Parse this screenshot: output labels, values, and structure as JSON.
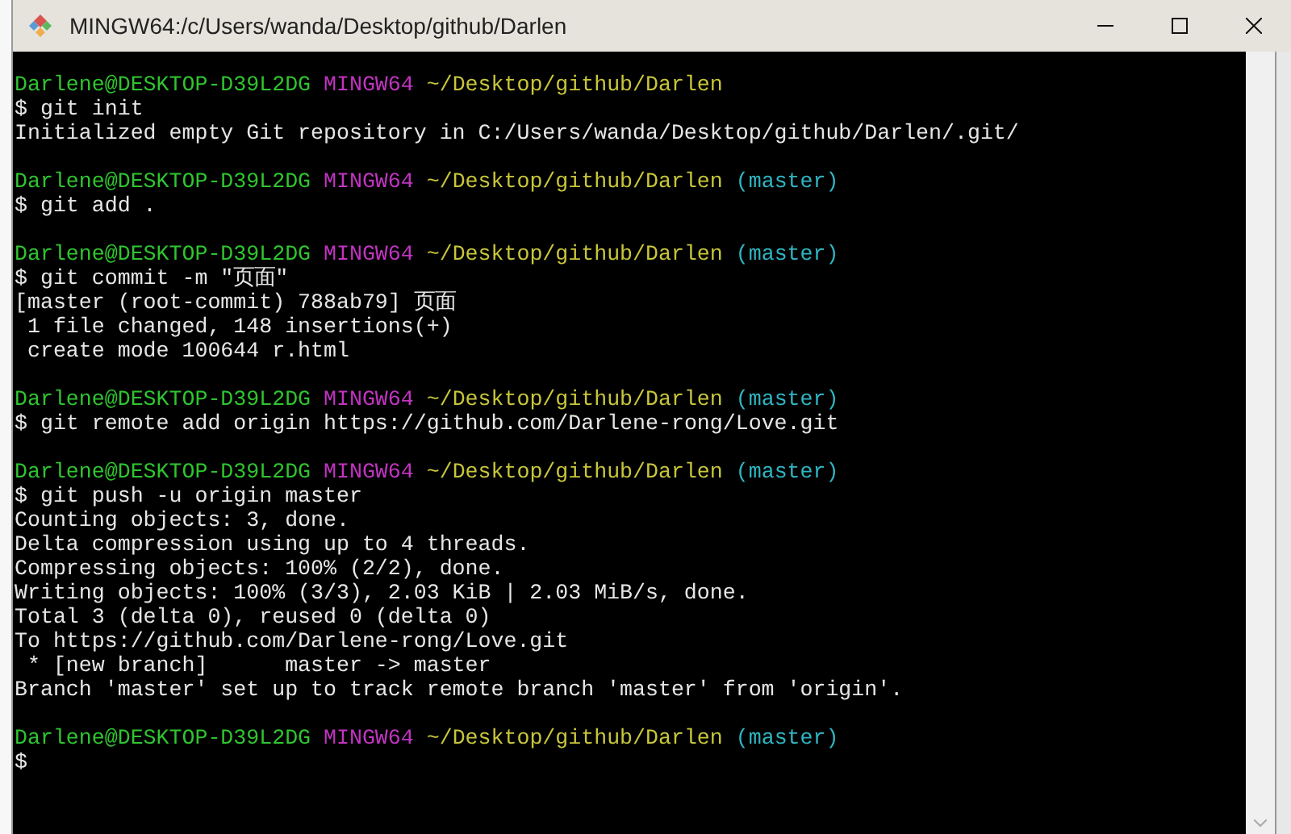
{
  "window": {
    "title": "MINGW64:/c/Users/wanda/Desktop/github/Darlen"
  },
  "terminal": {
    "lines": [
      {
        "kind": "prompt",
        "user": "Darlene@DESKTOP-D39L2DG",
        "system": "MINGW64",
        "path": "~/Desktop/github/Darlen"
      },
      {
        "kind": "command",
        "symbol": "$",
        "text": "git init"
      },
      {
        "kind": "output",
        "text": "Initialized empty Git repository in C:/Users/wanda/Desktop/github/Darlen/.git/"
      },
      {
        "kind": "blank"
      },
      {
        "kind": "prompt",
        "user": "Darlene@DESKTOP-D39L2DG",
        "system": "MINGW64",
        "path": "~/Desktop/github/Darlen",
        "branch": "(master)"
      },
      {
        "kind": "command",
        "symbol": "$",
        "text": "git add ."
      },
      {
        "kind": "blank"
      },
      {
        "kind": "prompt",
        "user": "Darlene@DESKTOP-D39L2DG",
        "system": "MINGW64",
        "path": "~/Desktop/github/Darlen",
        "branch": "(master)"
      },
      {
        "kind": "command",
        "symbol": "$",
        "text": "git commit -m \"页面\""
      },
      {
        "kind": "output",
        "text": "[master (root-commit) 788ab79] 页面"
      },
      {
        "kind": "output",
        "text": " 1 file changed, 148 insertions(+)"
      },
      {
        "kind": "output",
        "text": " create mode 100644 r.html"
      },
      {
        "kind": "blank"
      },
      {
        "kind": "prompt",
        "user": "Darlene@DESKTOP-D39L2DG",
        "system": "MINGW64",
        "path": "~/Desktop/github/Darlen",
        "branch": "(master)"
      },
      {
        "kind": "command",
        "symbol": "$",
        "text": "git remote add origin https://github.com/Darlene-rong/Love.git"
      },
      {
        "kind": "blank"
      },
      {
        "kind": "prompt",
        "user": "Darlene@DESKTOP-D39L2DG",
        "system": "MINGW64",
        "path": "~/Desktop/github/Darlen",
        "branch": "(master)"
      },
      {
        "kind": "command",
        "symbol": "$",
        "text": "git push -u origin master"
      },
      {
        "kind": "output",
        "text": "Counting objects: 3, done."
      },
      {
        "kind": "output",
        "text": "Delta compression using up to 4 threads."
      },
      {
        "kind": "output",
        "text": "Compressing objects: 100% (2/2), done."
      },
      {
        "kind": "output",
        "text": "Writing objects: 100% (3/3), 2.03 KiB | 2.03 MiB/s, done."
      },
      {
        "kind": "output",
        "text": "Total 3 (delta 0), reused 0 (delta 0)"
      },
      {
        "kind": "output",
        "text": "To https://github.com/Darlene-rong/Love.git"
      },
      {
        "kind": "output",
        "text": " * [new branch]      master -> master"
      },
      {
        "kind": "output",
        "text": "Branch 'master' set up to track remote branch 'master' from 'origin'."
      },
      {
        "kind": "blank"
      },
      {
        "kind": "prompt",
        "user": "Darlene@DESKTOP-D39L2DG",
        "system": "MINGW64",
        "path": "~/Desktop/github/Darlen",
        "branch": "(master)"
      },
      {
        "kind": "command",
        "symbol": "$"
      }
    ]
  }
}
